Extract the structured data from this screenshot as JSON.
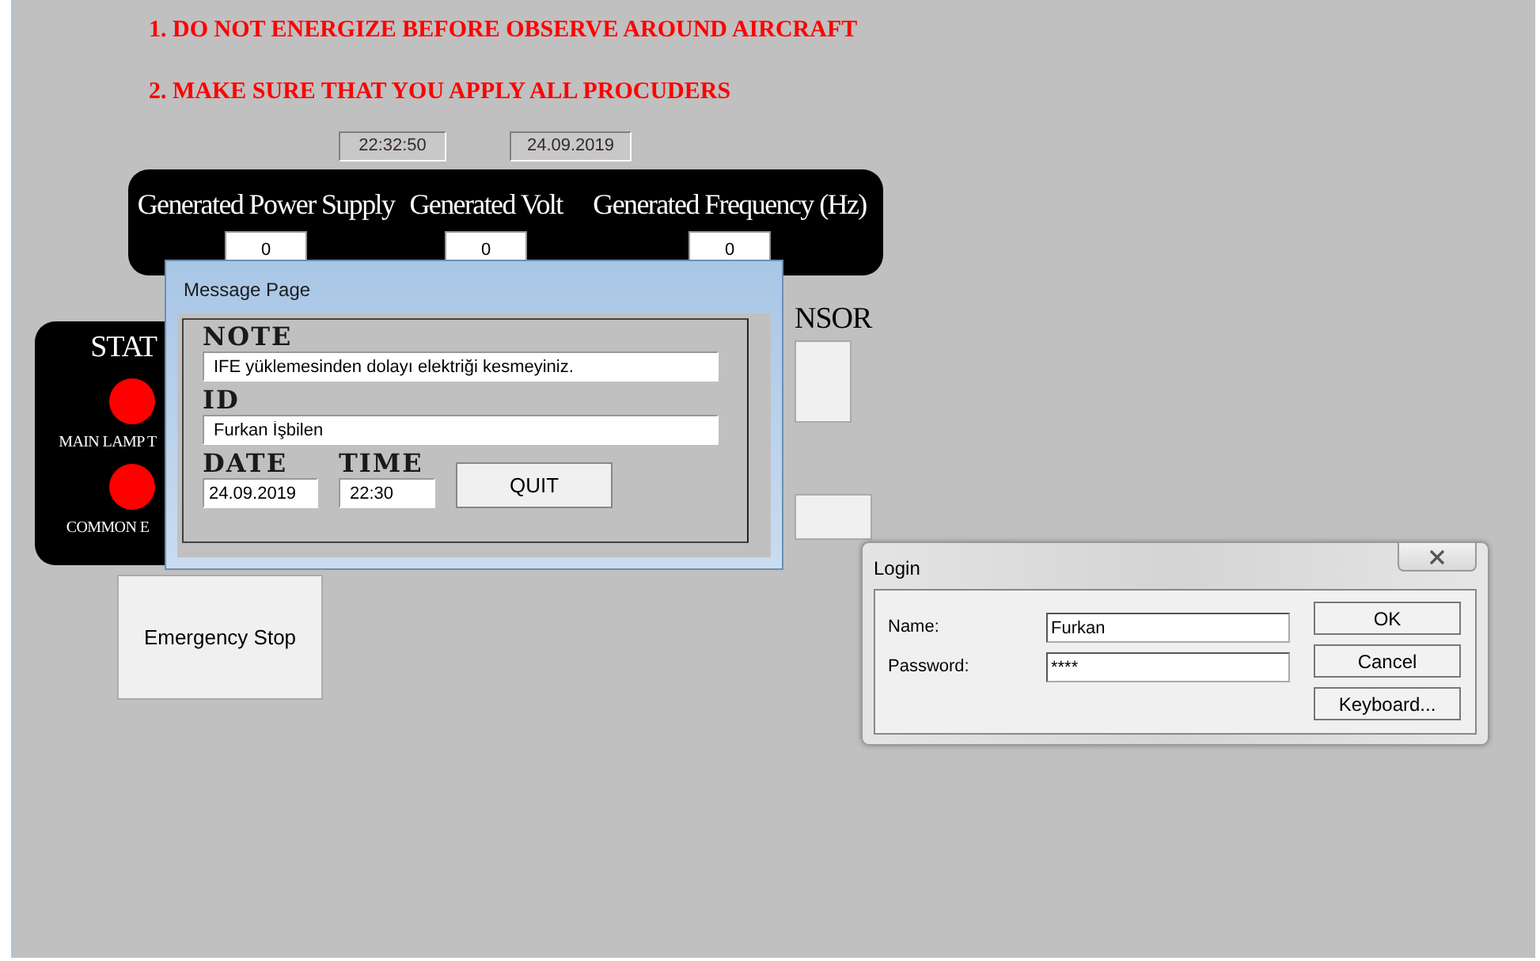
{
  "warnings": [
    "1. DO NOT ENERGIZE BEFORE OBSERVE AROUND AIRCRAFT",
    "2. MAKE SURE THAT YOU APPLY ALL PROCUDERS"
  ],
  "clock": {
    "time": "22:32:50",
    "date": "24.09.2019"
  },
  "generator_panel": {
    "items": [
      {
        "label": "Generated Power Supply",
        "value": "0"
      },
      {
        "label": "Generated Volt",
        "value": "0"
      },
      {
        "label": "Generated Frequency (Hz)",
        "value": "0"
      }
    ]
  },
  "status_panel": {
    "title": "STAT",
    "lamps": [
      {
        "label": "MAIN LAMP T",
        "on": true
      },
      {
        "label": "COMMON E",
        "on": true
      }
    ]
  },
  "sensor_heading": "NSOR",
  "emergency_stop_button": "Emergency Stop",
  "message_dialog": {
    "title": "Message Page",
    "note_label": "NOTE",
    "note": "IFE yüklemesinden dolayı elektriği kesmeyiniz.",
    "id_label": "ID",
    "id": "Furkan İşbilen",
    "date_label": "DATE",
    "date": "24.09.2019",
    "time_label": "TIME",
    "time": "22:30",
    "quit_button": "QUIT"
  },
  "login_dialog": {
    "title": "Login",
    "name_label": "Name:",
    "name": "Furkan",
    "password_label": "Password:",
    "password": "****",
    "buttons": [
      "OK",
      "Cancel",
      "Keyboard..."
    ]
  }
}
